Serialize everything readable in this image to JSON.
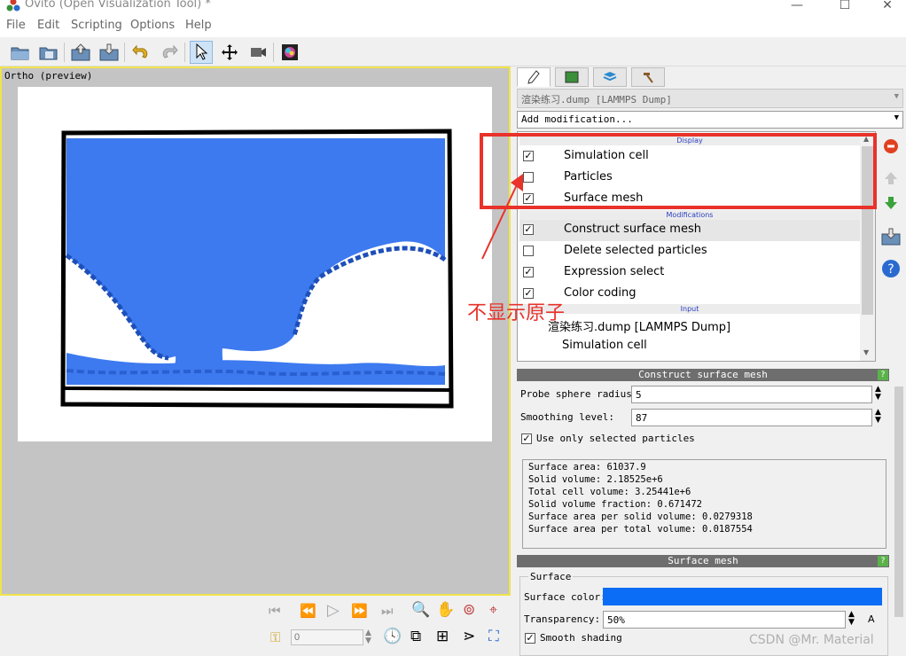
{
  "window": {
    "title": "Ovito (Open Visualization Tool) *"
  },
  "menu": [
    "File",
    "Edit",
    "Scripting",
    "Options",
    "Help"
  ],
  "toolbar": {
    "icons": [
      "open-file-icon",
      "save-icon",
      "import-icon",
      "export-icon",
      "undo-icon",
      "redo-icon",
      "select-pointer-icon",
      "move-icon",
      "fov-icon",
      "render-icon"
    ]
  },
  "viewport": {
    "label": "Ortho (preview)"
  },
  "animation": {
    "frame": "0"
  },
  "command_panel": {
    "pipeline_select": "渲染练习.dump [LAMMPS Dump]",
    "add_modification": "Add modification...",
    "sections": {
      "display": "Display",
      "modifications": "Modifications",
      "input": "Input"
    },
    "display_items": [
      {
        "label": "Simulation cell",
        "checked": true
      },
      {
        "label": "Particles",
        "checked": false
      },
      {
        "label": "Surface mesh",
        "checked": true
      }
    ],
    "modification_items": [
      {
        "label": "Construct surface mesh",
        "checked": true
      },
      {
        "label": "Delete selected particles",
        "checked": false
      },
      {
        "label": "Expression select",
        "checked": true
      },
      {
        "label": "Color coding",
        "checked": true
      }
    ],
    "input_items": [
      "渲染练习.dump [LAMMPS Dump]",
      "Simulation cell"
    ]
  },
  "construct_panel": {
    "title": "Construct surface mesh",
    "probe_label": "Probe sphere radius:",
    "probe_value": "5",
    "smoothing_label": "Smoothing level:",
    "smoothing_value": "87",
    "use_selected_label": "Use only selected particles",
    "results": [
      "Surface area: 61037.9",
      "Solid volume: 2.18525e+6",
      "Total cell volume: 3.25441e+6",
      "Solid volume fraction: 0.671472",
      "Surface area per solid volume: 0.0279318",
      "Surface area per total volume: 0.0187554"
    ]
  },
  "surface_panel": {
    "title": "Surface mesh",
    "group": "Surface",
    "color_label": "Surface color:",
    "color": "#0b6cf5",
    "transparency_label": "Transparency:",
    "transparency_value": "50%",
    "transparency_suffix": "A",
    "smooth_label": "Smooth shading"
  },
  "annotation": {
    "text": "不显示原子"
  },
  "watermark": "CSDN @Mr. Material"
}
